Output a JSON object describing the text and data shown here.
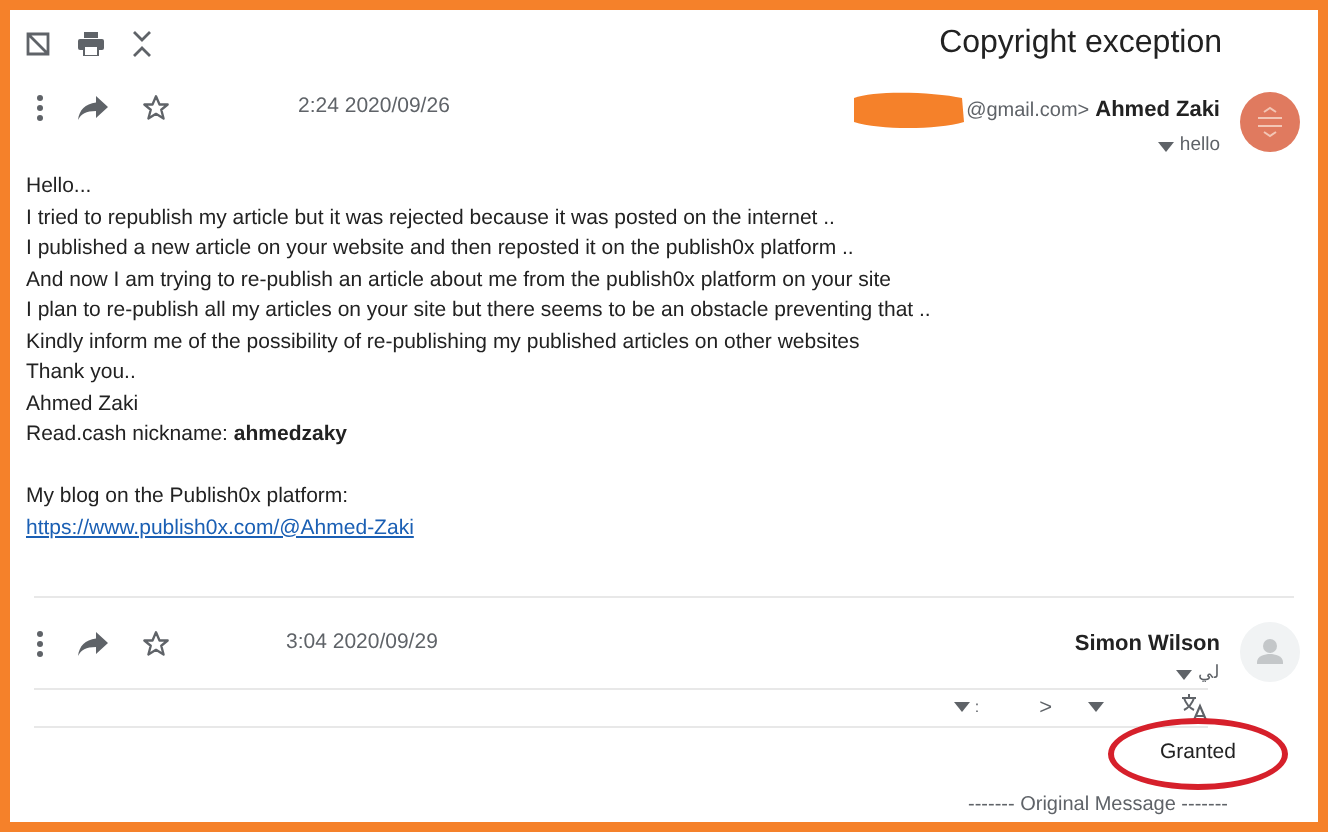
{
  "subject": "Copyright exception",
  "messages": [
    {
      "time": "2:24 2020/09/26",
      "sender_email_suffix": "@gmail.com>",
      "sender": "Ahmed Zaki",
      "recipient": "hello",
      "starred": false,
      "body": [
        {
          "kind": "line",
          "text": "Hello..."
        },
        {
          "kind": "line",
          "text": "I tried to republish my article but it was rejected because it was posted on the internet .."
        },
        {
          "kind": "line",
          "text": "I published a new article on your website and then reposted it on the publish0x platform .."
        },
        {
          "kind": "line",
          "text": "And now I am trying to re-publish an article about me from the publish0x platform on your site"
        },
        {
          "kind": "line",
          "text": "I plan to re-publish all my articles on your site but there seems to be an obstacle preventing that .."
        },
        {
          "kind": "line",
          "text": "Kindly inform me of the possibility of re-publishing my published articles on other websites"
        },
        {
          "kind": "line",
          "text": "Thank you.."
        },
        {
          "kind": "line",
          "text": "Ahmed Zaki"
        },
        {
          "kind": "line",
          "text": "Read.cash nickname: **ahmedzaky**"
        },
        {
          "kind": "blank"
        },
        {
          "kind": "line",
          "text": "My blog on the Publish0x platform:"
        },
        {
          "kind": "link",
          "text": "https://www.publish0x.com/@Ahmed-Zaki"
        }
      ]
    },
    {
      "time": "3:04 2020/09/29",
      "sender": "Simon Wilson",
      "recipient": "لي",
      "starred": false,
      "avatar": {
        "kind": "placeholder"
      },
      "translate_bar": {
        "separator": ":",
        "chevron": ">"
      },
      "body": [
        {
          "kind": "reply",
          "text": "Granted"
        }
      ],
      "quoted_header": "------- Original Message -------"
    }
  ]
}
